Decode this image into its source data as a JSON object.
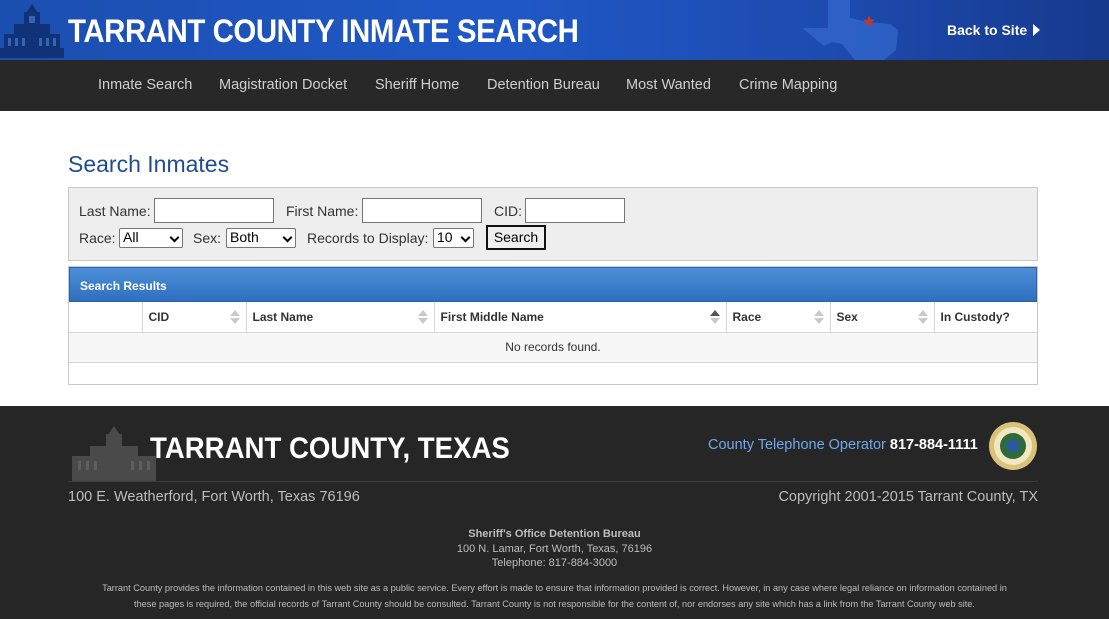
{
  "header": {
    "site_title": "TARRANT COUNTY INMATE SEARCH",
    "back_link": "Back to Site"
  },
  "nav": {
    "items": [
      {
        "label": "Inmate Search"
      },
      {
        "label": "Magistration Docket"
      },
      {
        "label": "Sheriff Home"
      },
      {
        "label": "Detention Bureau"
      },
      {
        "label": "Most Wanted"
      },
      {
        "label": "Crime Mapping"
      }
    ]
  },
  "main": {
    "page_title": "Search Inmates",
    "form": {
      "last_name_label": "Last Name:",
      "last_name_value": "",
      "first_name_label": "First Name:",
      "first_name_value": "",
      "cid_label": "CID:",
      "cid_value": "",
      "race_label": "Race:",
      "race_selected": "All",
      "sex_label": "Sex:",
      "sex_selected": "Both",
      "records_label": "Records to Display:",
      "records_selected": "10",
      "search_button": "Search"
    },
    "results": {
      "title": "Search Results",
      "columns": [
        "",
        "CID",
        "Last Name",
        "First Middle Name",
        "Race",
        "Sex",
        "In Custody?"
      ],
      "sorted_column": "First Middle Name",
      "empty_message": "No records found."
    }
  },
  "footer": {
    "title": "TARRANT COUNTY, TEXAS",
    "phone_label": "County Telephone Operator",
    "phone_number": "817-884-1111",
    "address": "100 E. Weatherford, Fort Worth, Texas 76196",
    "copyright": "Copyright 2001-2015 Tarrant County, TX",
    "bureau_name": "Sheriff's Office Detention Bureau",
    "bureau_address": "100 N. Lamar, Fort Worth, Texas, 76196",
    "bureau_phone": "Telephone: 817-884-3000",
    "disclaimer": "Tarrant County provides the information contained in this web site as a public service. Every effort is made to ensure that information provided is correct. However, in any case where legal reliance on information contained in these pages is required, the official records of Tarrant County should be consulted. Tarrant County is not responsible for the content of, nor endorses any site which has a link from the Tarrant County web site."
  },
  "colors": {
    "banner_blue": "#1f58c6",
    "nav_bg": "#282828",
    "title_blue": "#1f4e8c",
    "results_header_blue": "#3a7cc9",
    "footer_bg": "#262626",
    "phone_label_blue": "#6fa8ef",
    "texas_star_red": "#c0392b"
  },
  "icons": [
    "courthouse-logo-icon",
    "texas-map-icon",
    "play-arrow-icon",
    "sort-arrows-icon",
    "county-seal-icon"
  ]
}
